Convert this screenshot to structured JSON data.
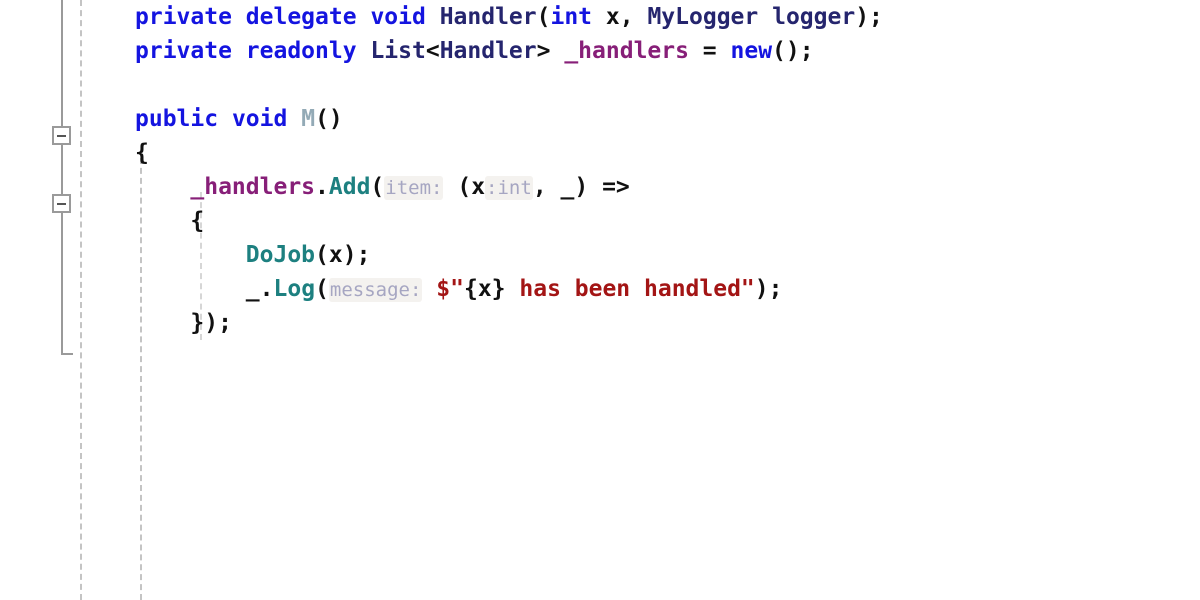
{
  "editor": {
    "language": "csharp",
    "background": "#ffffff",
    "font_size_px": 23,
    "line_height_px": 34,
    "colors": {
      "keyword": "#1414e0",
      "type": "#25256e",
      "field": "#871f78",
      "method": "#1d8080",
      "method_unused": "#93aab6",
      "string": "#a31515",
      "inlay_hint_text": "#a6a6c2",
      "inlay_hint_background": "#f4f2ef",
      "plain_text": "#111111",
      "indent_guide": "#c4c4c4",
      "fold_rail": "#9a9a9a",
      "squiggle": "#2b46d8"
    }
  },
  "gutter": {
    "fold_markers": [
      {
        "name": "fold-marker-method-m",
        "glyph": "minus",
        "state": "expanded"
      },
      {
        "name": "fold-marker-lambda",
        "glyph": "minus",
        "state": "expanded"
      }
    ]
  },
  "code": {
    "lines": [
      {
        "id": "line-1",
        "tokens": [
          {
            "t": "private",
            "c": "kw"
          },
          {
            "t": " ",
            "c": "plain"
          },
          {
            "t": "delegate",
            "c": "kw"
          },
          {
            "t": " ",
            "c": "plain"
          },
          {
            "t": "void",
            "c": "kw"
          },
          {
            "t": " ",
            "c": "plain"
          },
          {
            "t": "Handler",
            "c": "type"
          },
          {
            "t": "(",
            "c": "punct"
          },
          {
            "t": "int",
            "c": "kw"
          },
          {
            "t": " ",
            "c": "plain"
          },
          {
            "t": "x",
            "c": "plain"
          },
          {
            "t": ", ",
            "c": "punct"
          },
          {
            "t": "MyLogger",
            "c": "type"
          },
          {
            "t": " ",
            "c": "plain"
          },
          {
            "t": "logger",
            "c": "type"
          },
          {
            "t": ");",
            "c": "punct"
          }
        ]
      },
      {
        "id": "line-2",
        "tokens": [
          {
            "t": "private",
            "c": "kw"
          },
          {
            "t": " ",
            "c": "plain"
          },
          {
            "t": "readonly",
            "c": "kw"
          },
          {
            "t": " ",
            "c": "plain"
          },
          {
            "t": "List",
            "c": "type"
          },
          {
            "t": "<",
            "c": "punct"
          },
          {
            "t": "Handler",
            "c": "type"
          },
          {
            "t": "> ",
            "c": "punct"
          },
          {
            "t": "_handlers",
            "c": "field"
          },
          {
            "t": " = ",
            "c": "punct"
          },
          {
            "t": "new",
            "c": "kw"
          },
          {
            "t": "();",
            "c": "punct"
          }
        ]
      },
      {
        "id": "line-3",
        "tokens": []
      },
      {
        "id": "line-4",
        "tokens": [
          {
            "t": "public",
            "c": "kw"
          },
          {
            "t": " ",
            "c": "plain"
          },
          {
            "t": "void",
            "c": "kw"
          },
          {
            "t": " ",
            "c": "plain"
          },
          {
            "t": "M",
            "c": "method-un"
          },
          {
            "t": "()",
            "c": "punct"
          }
        ]
      },
      {
        "id": "line-5",
        "tokens": [
          {
            "t": "{",
            "c": "punct"
          }
        ]
      },
      {
        "id": "line-6",
        "tokens": [
          {
            "t": "    ",
            "c": "plain"
          },
          {
            "t": "_handlers",
            "c": "field"
          },
          {
            "t": ".",
            "c": "punct"
          },
          {
            "t": "Add",
            "c": "method"
          },
          {
            "t": "(",
            "c": "punct"
          },
          {
            "t": "item:",
            "c": "hint"
          },
          {
            "t": " (",
            "c": "punct"
          },
          {
            "t": "x",
            "c": "plain"
          },
          {
            "t": ":int",
            "c": "hint"
          },
          {
            "t": ", ",
            "c": "punct"
          },
          {
            "t": "_",
            "c": "plain squiggle-token"
          },
          {
            "t": ") ",
            "c": "punct"
          },
          {
            "t": "=>",
            "c": "punct"
          }
        ]
      },
      {
        "id": "line-7",
        "tokens": [
          {
            "t": "    ",
            "c": "plain"
          },
          {
            "t": "{",
            "c": "punct"
          }
        ]
      },
      {
        "id": "line-8",
        "tokens": [
          {
            "t": "        ",
            "c": "plain"
          },
          {
            "t": "DoJob",
            "c": "method"
          },
          {
            "t": "(",
            "c": "punct"
          },
          {
            "t": "x",
            "c": "plain"
          },
          {
            "t": ");",
            "c": "punct"
          }
        ]
      },
      {
        "id": "line-9",
        "tokens": [
          {
            "t": "        ",
            "c": "plain"
          },
          {
            "t": "_",
            "c": "plain"
          },
          {
            "t": ".",
            "c": "punct"
          },
          {
            "t": "Log",
            "c": "method"
          },
          {
            "t": "(",
            "c": "punct"
          },
          {
            "t": "message:",
            "c": "hint"
          },
          {
            "t": " ",
            "c": "plain"
          },
          {
            "t": "$\"",
            "c": "str"
          },
          {
            "t": "{x}",
            "c": "str-hole"
          },
          {
            "t": " has been handled\"",
            "c": "str"
          },
          {
            "t": ");",
            "c": "punct"
          }
        ]
      },
      {
        "id": "line-10",
        "tokens": [
          {
            "t": "    ",
            "c": "plain"
          },
          {
            "t": "});",
            "c": "punct"
          }
        ]
      }
    ]
  }
}
